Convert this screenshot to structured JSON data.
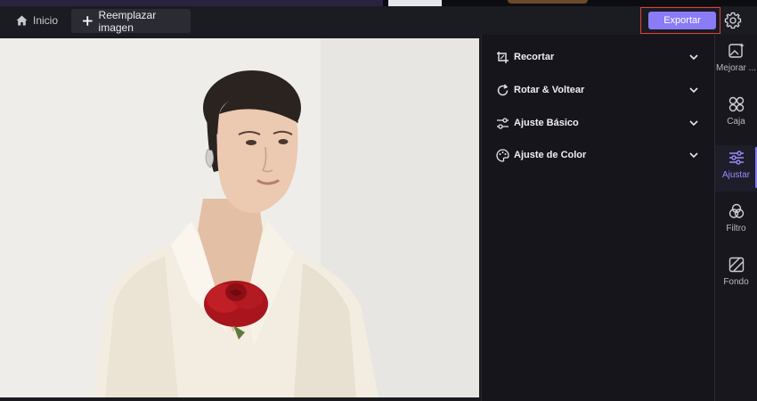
{
  "header": {
    "home_label": "Inicio",
    "replace_label": "Reemplazar imagen",
    "export_label": "Exportar"
  },
  "panel": {
    "sections": [
      {
        "label": "Recortar",
        "icon": "crop-icon"
      },
      {
        "label": "Rotar & Voltear",
        "icon": "rotate-icon"
      },
      {
        "label": "Ajuste Básico",
        "icon": "sliders-icon"
      },
      {
        "label": "Ajuste de Color",
        "icon": "palette-icon"
      }
    ]
  },
  "rail": {
    "items": [
      {
        "label": "Mejorar ...",
        "icon": "enhance-image-icon"
      },
      {
        "label": "Caja",
        "icon": "box-grid-icon"
      },
      {
        "label": "Ajustar",
        "icon": "adjust-sliders-icon",
        "active": true
      },
      {
        "label": "Filtro",
        "icon": "filter-circles-icon"
      },
      {
        "label": "Fondo",
        "icon": "background-icon"
      }
    ]
  },
  "colors": {
    "accent": "#8a7bf6",
    "highlight_border": "#e0403a",
    "background": "#141419"
  }
}
